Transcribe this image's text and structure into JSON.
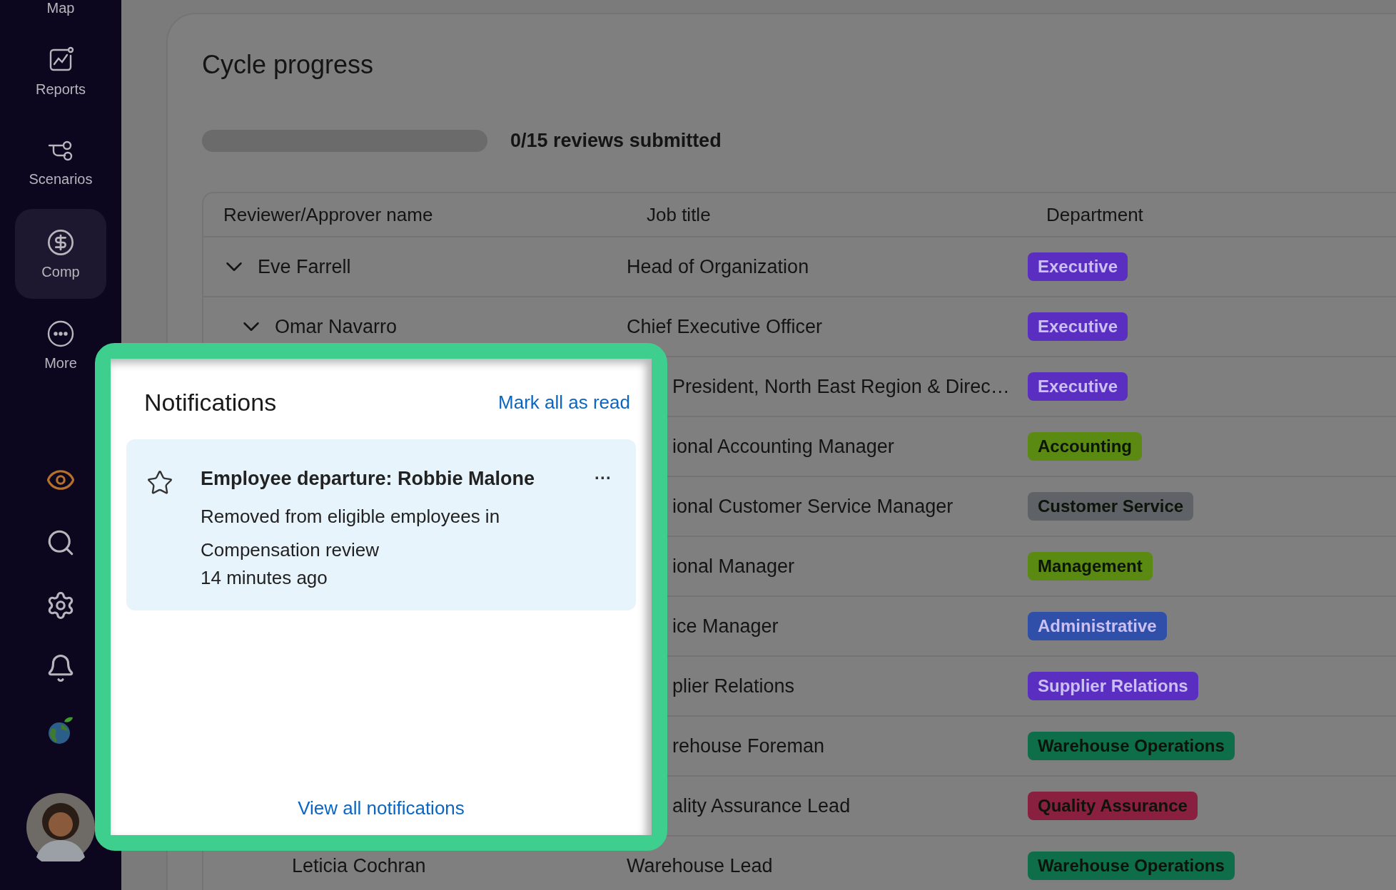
{
  "sidebar": {
    "nav": [
      {
        "label": "Map",
        "selected": false
      },
      {
        "label": "Reports",
        "selected": false
      },
      {
        "label": "Scenarios",
        "selected": false
      },
      {
        "label": "Comp",
        "selected": true
      },
      {
        "label": "More",
        "selected": false
      }
    ]
  },
  "cycle": {
    "title": "Cycle progress",
    "progress": {
      "level": 0
    },
    "summary": "0/15 reviews submitted"
  },
  "table": {
    "columns": [
      "Reviewer/Approver name",
      "Job title",
      "Department"
    ],
    "rows": [
      {
        "name": "Eve Farrell",
        "job_title": "Head of Organization",
        "department": {
          "label": "Executive",
          "color": "#5a2ec0"
        },
        "expanded": true,
        "children": [
          {
            "name": "Omar Navarro",
            "job_title": "Chief Executive Officer",
            "department": {
              "label": "Executive",
              "color": "#5a2ec0"
            },
            "expanded": true,
            "children": [
              {
                "job_title": "President, North East Region & Direc…",
                "department": {
                  "label": "Executive",
                  "color": "#5a2ec0"
                }
              },
              {
                "job_title": "ional Accounting Manager",
                "department": {
                  "label": "Accounting",
                  "color": "#5a8a12"
                }
              },
              {
                "job_title": "ional Customer Service Manager",
                "department": {
                  "label": "Customer Service",
                  "color": "#5f6266"
                }
              },
              {
                "job_title": "ional Manager",
                "department": {
                  "label": "Management",
                  "color": "#5a8a12"
                }
              },
              {
                "job_title": "ice Manager",
                "department": {
                  "label": "Administrative",
                  "color": "#2f4fa8"
                }
              },
              {
                "job_title": "plier Relations",
                "department": {
                  "label": "Supplier Relations",
                  "color": "#5a2ec0"
                }
              },
              {
                "job_title": "rehouse Foreman",
                "department": {
                  "label": "Warehouse Operations",
                  "color": "#0e6e4a"
                }
              },
              {
                "job_title": "ality Assurance Lead",
                "department": {
                  "label": "Quality Assurance",
                  "color": "#8a2040"
                }
              },
              {
                "name": "Leticia Cochran",
                "job_title": "Warehouse Lead",
                "department": {
                  "label": "Warehouse Operations",
                  "color": "#0e6e4a"
                }
              }
            ]
          }
        ]
      }
    ]
  },
  "notifications": {
    "title": "Notifications",
    "mark_all": "Mark all as read",
    "items": [
      {
        "title": "Employee departure: Robbie Malone",
        "body": "Removed from eligible employees in Compensation review",
        "time": "14 minutes ago",
        "starred": false,
        "unread": true,
        "menu": "···"
      }
    ],
    "view_all": "View all notifications"
  }
}
